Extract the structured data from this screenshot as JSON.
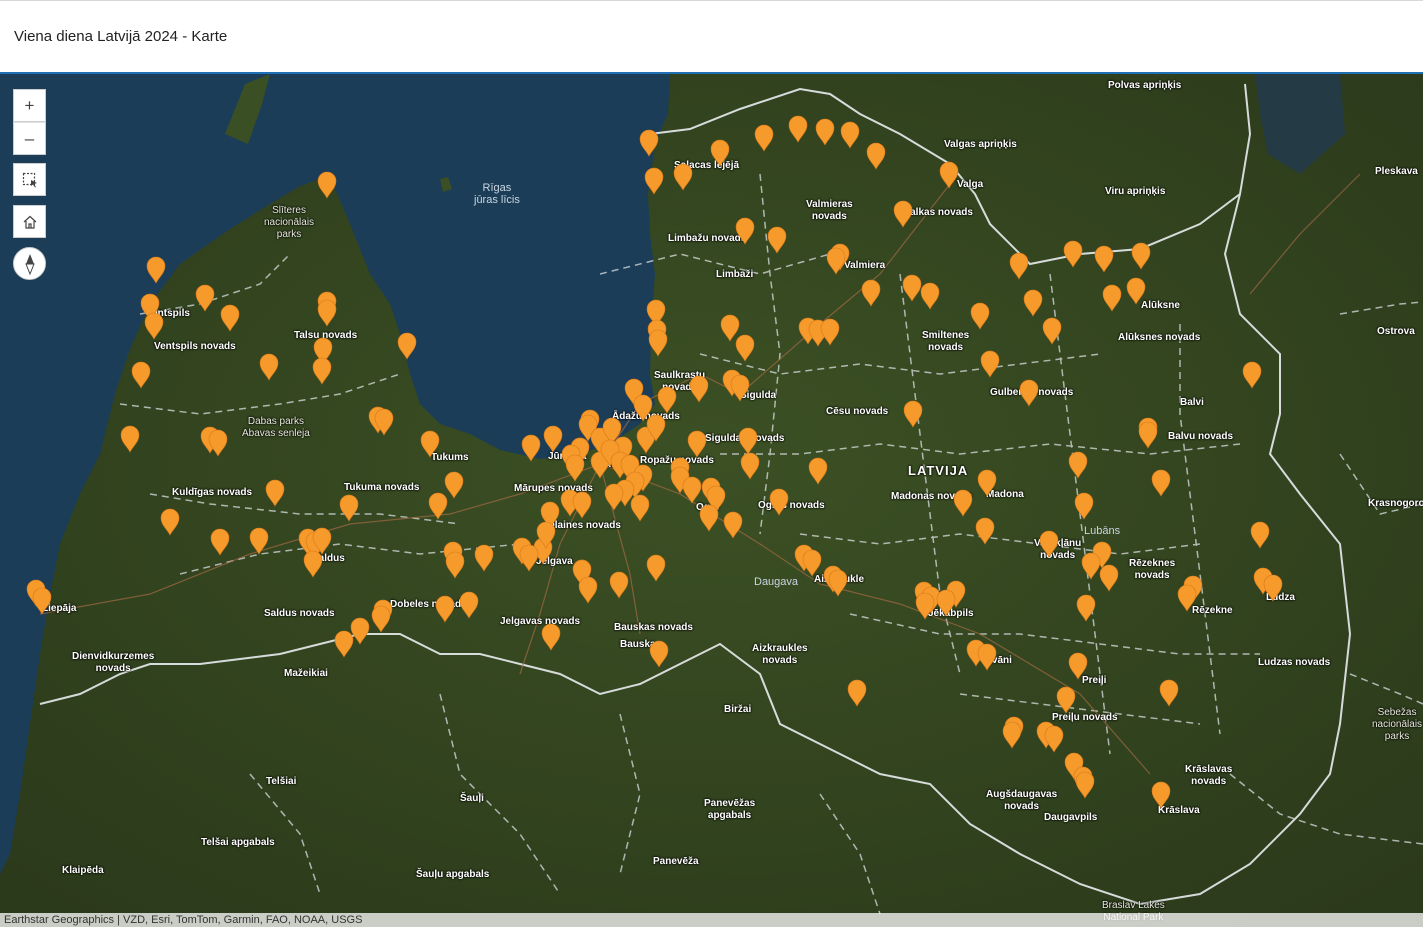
{
  "header": {
    "title": "Viena diena Latvijā 2024 - Karte"
  },
  "controls": {
    "zoom_in": "+",
    "zoom_out": "–",
    "select_icon": "select-icon",
    "home_icon": "home-icon",
    "compass_icon": "compass-icon"
  },
  "attribution": "Earthstar Geographics | VZD, Esri, TomTom, Garmin, FAO, NOAA, USGS",
  "colors": {
    "marker": "#f59a2b",
    "sea": "#1b3d57",
    "land": "#33461f",
    "border": "#e9ecef",
    "frame": "#1f6fb5"
  },
  "labels": {
    "polvas": "Polvas apriņķis",
    "valgas": "Valgas apriņķis",
    "pleskava": "Pleskava",
    "viru": "Viru apriņķis",
    "valga": "Valga",
    "salacas": "Salacas lejējā",
    "valmieras_n": "Valmieras\nnovads",
    "valkas": "Valkas novads",
    "rigas_licis": "Rīgas\njūras līcis",
    "slitere": "Slīteres\nnacionālais\nparks",
    "limbazu_n": "Limbažu novads",
    "limbazi": "Limbaži",
    "valmiera": "Valmiera",
    "aluksne": "Alūksne",
    "ostrova": "Ostrova",
    "ventspils": "Ventspils",
    "ventspils_n": "Ventspils novads",
    "talsu_n": "Talsu novads",
    "smiltenes_n": "Smiltenes\nnovads",
    "aluksnes_n": "Alūksnes novads",
    "saulkrastu_n": "Saulkrastu\nnovads",
    "sigulda": "Sigulda",
    "gulbenes_n": "Gulbenes novads",
    "abava": "Dabas parks\nAbavas senleja",
    "adazu_n": "Ādažu novads",
    "cesu_n": "Cēsu novads",
    "balvi": "Balvi",
    "siguldas_n": "Siguldas novads",
    "balvu_n": "Balvu novads",
    "tukums": "Tukums",
    "jurmala": "Jūrmala",
    "riga": "Rīga",
    "ropazu_n": "Ropažu novads",
    "latvija": "LATVIJA",
    "kuldigas_n": "Kuldīgas novads",
    "tukuma_n": "Tukuma novads",
    "marupes_n": "Mārupes novads",
    "madonas_n": "Madonas novads",
    "madona": "Madona",
    "krasnogorod": "Krasnogorod",
    "ogre": "Ogre",
    "ogres_n": "Ogres novads",
    "olaines_n": "Olaines novads",
    "lubans": "Lubāns",
    "saldus": "Saldus",
    "jelgava": "Jelgava",
    "varaklanu_n": "Varakļānu\nnovads",
    "rezeknes_n": "Rēzeknes\nnovads",
    "daugava": "Daugava",
    "aizkraukle": "Aizkraukle",
    "liepaja": "Liepāja",
    "dobeles_n": "Dobeles novads",
    "saldus_n": "Saldus novads",
    "jekabpils": "Jēkabpils",
    "rezekne": "Rēzekne",
    "ludza": "Ludza",
    "jelgavas_n": "Jelgavas novads",
    "bauskas_n": "Bauskas novads",
    "bauska": "Bauska",
    "dienvidkurzemes_n": "Dienvidkurzemes\nnovads",
    "aizkraukles_n": "Aizkraukles\nnovads",
    "livani": "Līvāni",
    "ludzas_n": "Ludzas novads",
    "mazeikiai": "Mažeikiai",
    "preili": "Preiļi",
    "birzai": "Biržai",
    "prelu_n": "Preiļu novads",
    "sebezas": "Sebežas\nnacionālais\nparks",
    "telsiai": "Telšiai",
    "kraslavas_n": "Krāslavas\nnovads",
    "augsdaugavas_n": "Augšdaugavas\nnovads",
    "siauliai": "Šauļi",
    "panevezas_a": "Panevēžas\napgabals",
    "kraslava": "Krāslava",
    "daugavpils": "Daugavpils",
    "telsai_a": "Telšai apgabals",
    "panevezas": "Panevēža",
    "klaipeda": "Klaipēda",
    "saulu_a": "Šauļu apgabals",
    "braslav": "Braslav Lakes\nNational Park"
  }
}
